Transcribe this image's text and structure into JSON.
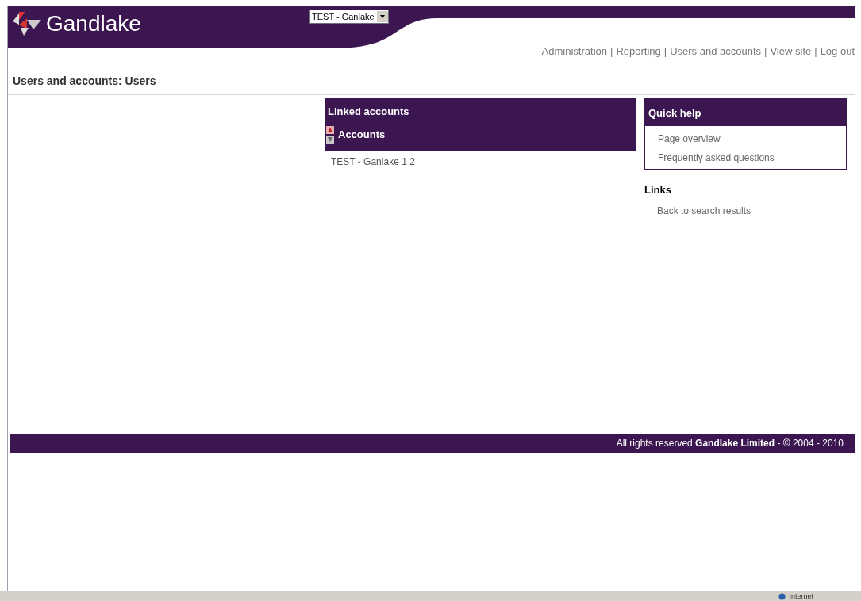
{
  "header": {
    "logo_text": "Gandlake",
    "account_select": {
      "value": "TEST - Ganlake"
    }
  },
  "nav": {
    "separator": "|",
    "links": [
      "Administration",
      "Reporting",
      "Users and accounts",
      "View site",
      "Log out"
    ]
  },
  "page_title": "Users and accounts: Users",
  "linked_accounts": {
    "title": "Linked accounts",
    "column": "Accounts",
    "rows": [
      "TEST - Ganlake 1 2"
    ]
  },
  "quick_help": {
    "title": "Quick help",
    "links": [
      "Page overview",
      "Frequently asked questions"
    ]
  },
  "links": {
    "title": "Links",
    "items": [
      "Back to search results"
    ]
  },
  "footer": "All rights reserved **Gandlake Limited** - © 2004 - 2010",
  "status_bar": {
    "zone": "Internet"
  }
}
